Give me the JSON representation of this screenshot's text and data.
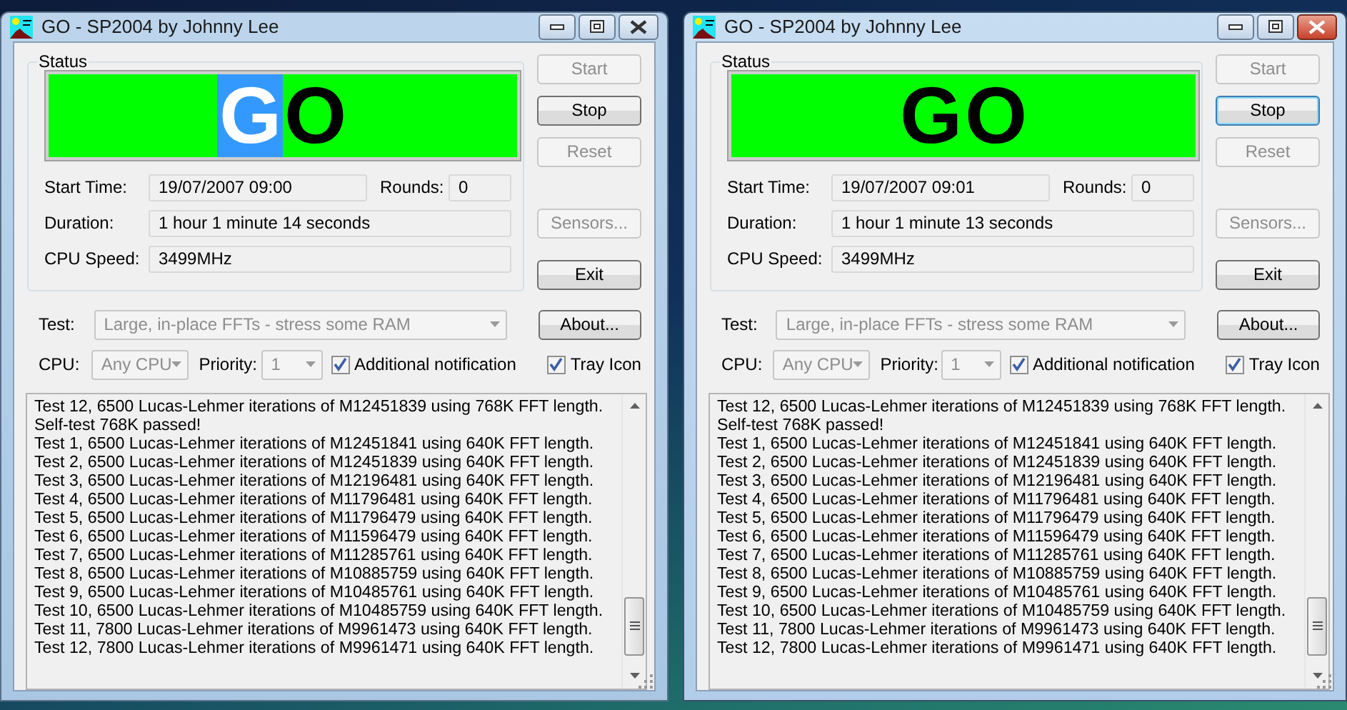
{
  "windows": [
    {
      "title": "GO - SP2004 by Johnny Lee",
      "active": false,
      "status_label": "Status",
      "display": {
        "letters": [
          {
            "char": "G",
            "highlighted": true
          },
          {
            "char": "O",
            "highlighted": false
          }
        ]
      },
      "fields": [
        {
          "label": "Start Time:",
          "value": "19/07/2007 09:00",
          "extra_label": "Rounds:",
          "extra_value": "0"
        },
        {
          "label": "Duration:",
          "value": "1 hour  1 minute  14 seconds"
        },
        {
          "label": "CPU Speed:",
          "value": "3499MHz"
        }
      ],
      "buttons": [
        {
          "label": "Start",
          "disabled": true,
          "focused": false
        },
        {
          "label": "Stop",
          "disabled": false,
          "focused": false
        },
        {
          "label": "Reset",
          "disabled": true,
          "focused": false
        },
        {
          "label": "Sensors...",
          "disabled": true,
          "focused": false
        },
        {
          "label": "Exit",
          "disabled": false,
          "focused": false
        },
        {
          "label": "About...",
          "disabled": false,
          "focused": false
        }
      ],
      "test_label": "Test:",
      "test_value": "Large, in-place FFTs - stress some RAM",
      "cpu_label": "CPU:",
      "cpu_value": "Any CPU",
      "priority_label": "Priority:",
      "priority_value": "1",
      "checkboxes": [
        {
          "label": "Additional notification",
          "checked": true
        },
        {
          "label": "Tray Icon",
          "checked": true
        }
      ],
      "log": [
        "Test 12, 6500 Lucas-Lehmer iterations of M12451839 using 768K FFT length.",
        "Self-test 768K passed!",
        "Test 1, 6500 Lucas-Lehmer iterations of M12451841 using 640K FFT length.",
        "Test 2, 6500 Lucas-Lehmer iterations of M12451839 using 640K FFT length.",
        "Test 3, 6500 Lucas-Lehmer iterations of M12196481 using 640K FFT length.",
        "Test 4, 6500 Lucas-Lehmer iterations of M11796481 using 640K FFT length.",
        "Test 5, 6500 Lucas-Lehmer iterations of M11796479 using 640K FFT length.",
        "Test 6, 6500 Lucas-Lehmer iterations of M11596479 using 640K FFT length.",
        "Test 7, 6500 Lucas-Lehmer iterations of M11285761 using 640K FFT length.",
        "Test 8, 6500 Lucas-Lehmer iterations of M10885759 using 640K FFT length.",
        "Test 9, 6500 Lucas-Lehmer iterations of M10485761 using 640K FFT length.",
        "Test 10, 6500 Lucas-Lehmer iterations of M10485759 using 640K FFT length.",
        "Test 11, 7800 Lucas-Lehmer iterations of M9961473 using 640K FFT length.",
        "Test 12, 7800 Lucas-Lehmer iterations of M9961471 using 640K FFT length."
      ]
    },
    {
      "title": "GO - SP2004 by Johnny Lee",
      "active": true,
      "status_label": "Status",
      "display": {
        "letters": [
          {
            "char": "G",
            "highlighted": false
          },
          {
            "char": "O",
            "highlighted": false
          }
        ]
      },
      "fields": [
        {
          "label": "Start Time:",
          "value": "19/07/2007 09:01",
          "extra_label": "Rounds:",
          "extra_value": "0"
        },
        {
          "label": "Duration:",
          "value": "1 hour  1 minute  13 seconds"
        },
        {
          "label": "CPU Speed:",
          "value": "3499MHz"
        }
      ],
      "buttons": [
        {
          "label": "Start",
          "disabled": true,
          "focused": false
        },
        {
          "label": "Stop",
          "disabled": false,
          "focused": true
        },
        {
          "label": "Reset",
          "disabled": true,
          "focused": false
        },
        {
          "label": "Sensors...",
          "disabled": true,
          "focused": false
        },
        {
          "label": "Exit",
          "disabled": false,
          "focused": false
        },
        {
          "label": "About...",
          "disabled": false,
          "focused": false
        }
      ],
      "test_label": "Test:",
      "test_value": "Large, in-place FFTs - stress some RAM",
      "cpu_label": "CPU:",
      "cpu_value": "Any CPU",
      "priority_label": "Priority:",
      "priority_value": "1",
      "checkboxes": [
        {
          "label": "Additional notification",
          "checked": true
        },
        {
          "label": "Tray Icon",
          "checked": true
        }
      ],
      "log": [
        "Test 12, 6500 Lucas-Lehmer iterations of M12451839 using 768K FFT length.",
        "Self-test 768K passed!",
        "Test 1, 6500 Lucas-Lehmer iterations of M12451841 using 640K FFT length.",
        "Test 2, 6500 Lucas-Lehmer iterations of M12451839 using 640K FFT length.",
        "Test 3, 6500 Lucas-Lehmer iterations of M12196481 using 640K FFT length.",
        "Test 4, 6500 Lucas-Lehmer iterations of M11796481 using 640K FFT length.",
        "Test 5, 6500 Lucas-Lehmer iterations of M11796479 using 640K FFT length.",
        "Test 6, 6500 Lucas-Lehmer iterations of M11596479 using 640K FFT length.",
        "Test 7, 6500 Lucas-Lehmer iterations of M11285761 using 640K FFT length.",
        "Test 8, 6500 Lucas-Lehmer iterations of M10885759 using 640K FFT length.",
        "Test 9, 6500 Lucas-Lehmer iterations of M10485761 using 640K FFT length.",
        "Test 10, 6500 Lucas-Lehmer iterations of M10485759 using 640K FFT length.",
        "Test 11, 7800 Lucas-Lehmer iterations of M9961473 using 640K FFT length.",
        "Test 12, 7800 Lucas-Lehmer iterations of M9961471 using 640K FFT length."
      ]
    }
  ]
}
